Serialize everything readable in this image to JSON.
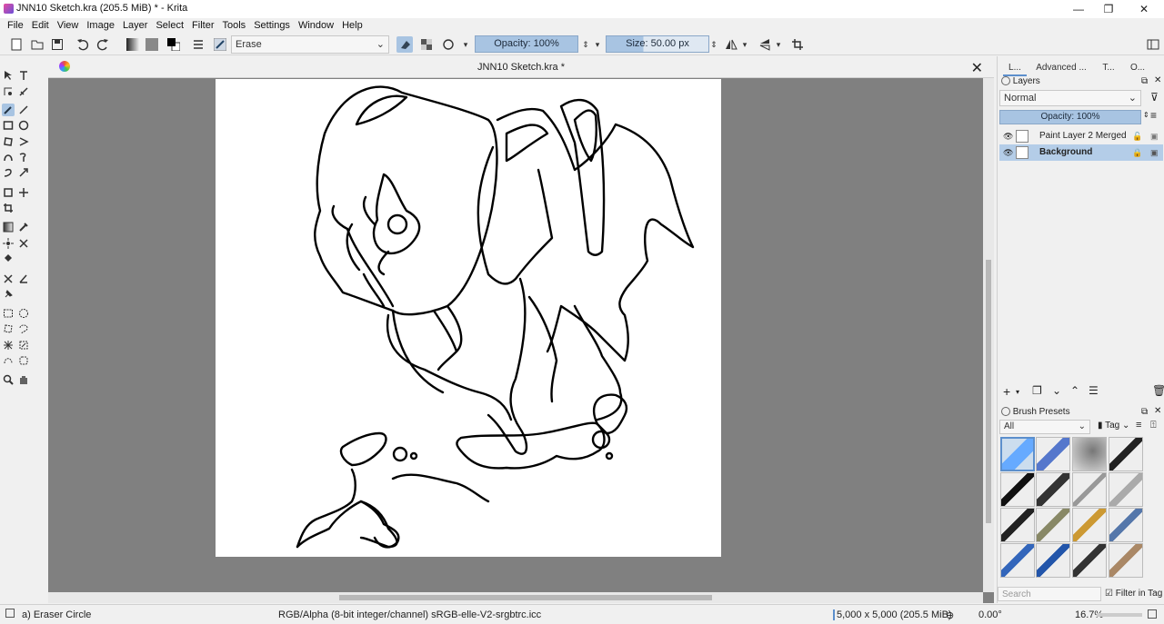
{
  "window": {
    "title": "JNN10 Sketch.kra (205.5 MiB)  * - Krita",
    "minimize": "—",
    "maximize": "❐",
    "close": "✕"
  },
  "menu": [
    "File",
    "Edit",
    "View",
    "Image",
    "Layer",
    "Select",
    "Filter",
    "Tools",
    "Settings",
    "Window",
    "Help"
  ],
  "toolbar": {
    "blend_mode": "Erase",
    "opacity": "Opacity: 100%",
    "size": "Size: 50.00 px"
  },
  "document": {
    "tab_title": "JNN10 Sketch.kra *"
  },
  "dock": {
    "tabs": [
      "L...",
      "Advanced ...",
      "T...",
      "O..."
    ],
    "layers": {
      "header": "Layers",
      "blend_mode": "Normal",
      "opacity": "Opacity:  100%",
      "items": [
        {
          "name": "Paint Layer 2 Merged",
          "selected": false
        },
        {
          "name": "Background",
          "selected": true
        }
      ]
    },
    "brush_presets": {
      "header": "Brush Presets",
      "filter": "All",
      "tag": "Tag",
      "search_placeholder": "Search",
      "filter_in_tag": "Filter in Tag"
    }
  },
  "statusbar": {
    "brush": "a) Eraser Circle",
    "color_space": "RGB/Alpha (8-bit integer/channel)  sRGB-elle-V2-srgbtrc.icc",
    "image_size": "5,000 x 5,000 (205.5 MiB)",
    "rotation": "0.00°",
    "zoom": "16.7%"
  },
  "colors": {
    "accent": "#a8c4e2",
    "canvas_bg": "#808080",
    "selected_layer": "#b4cde8"
  }
}
